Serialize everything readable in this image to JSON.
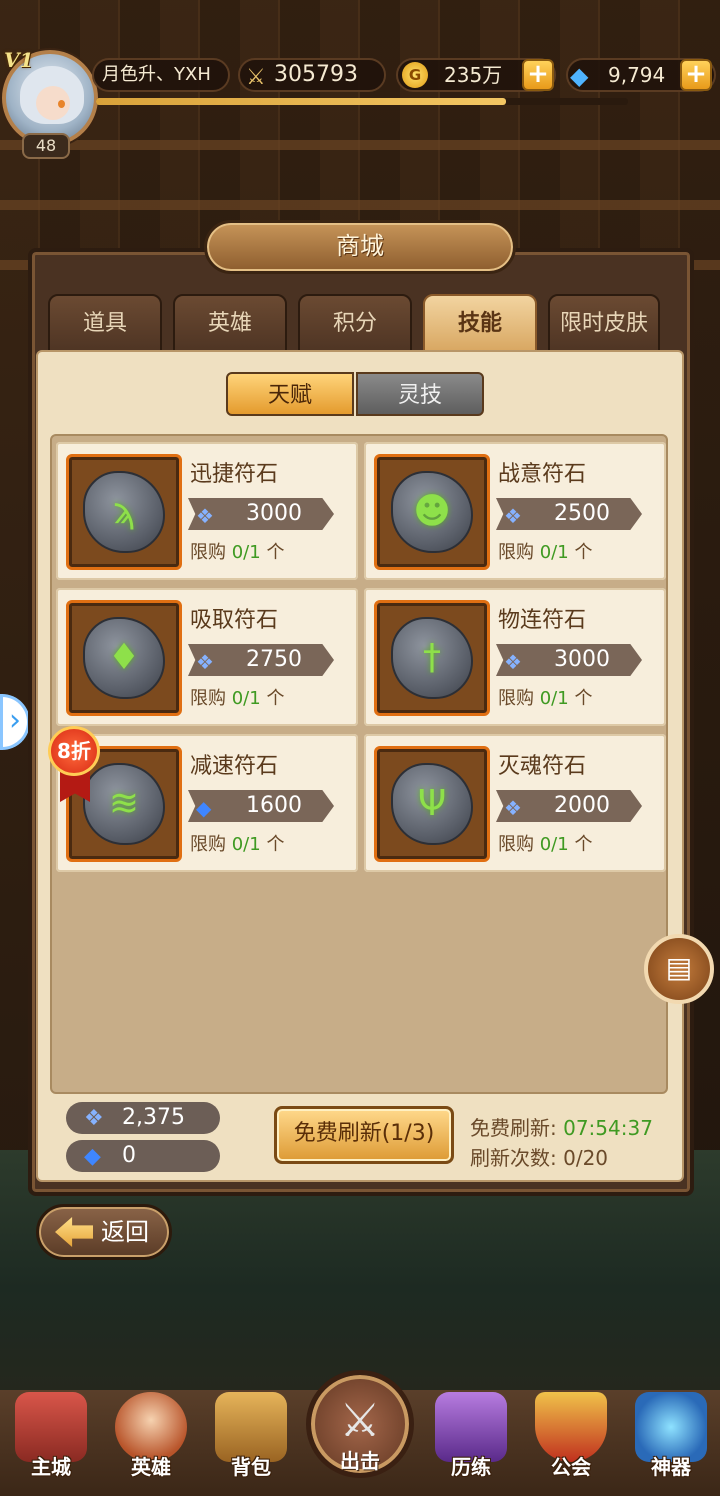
{
  "player": {
    "vip": "V1",
    "name": "月色升、YXH",
    "level": "48",
    "power": "305793",
    "gold": "235万",
    "gems": "9,794",
    "xp_fraction": 0.77
  },
  "shop": {
    "title": "商城",
    "tabs": [
      {
        "label": "道具"
      },
      {
        "label": "英雄"
      },
      {
        "label": "积分"
      },
      {
        "label": "技能"
      },
      {
        "label": "限时皮肤"
      }
    ],
    "active_tab": "技能",
    "subtabs": [
      {
        "label": "天赋"
      },
      {
        "label": "灵技"
      }
    ],
    "items": [
      {
        "name": "迅捷符石",
        "price": "3000",
        "limit_label": "限购",
        "limit": "0/1",
        "unit": "个",
        "icon": "boot-rune-icon"
      },
      {
        "name": "战意符石",
        "price": "2500",
        "limit_label": "限购",
        "limit": "0/1",
        "unit": "个",
        "icon": "demon-rune-icon"
      },
      {
        "name": "吸取符石",
        "price": "2750",
        "limit_label": "限购",
        "limit": "0/1",
        "unit": "个",
        "icon": "drops-rune-icon"
      },
      {
        "name": "物连符石",
        "price": "3000",
        "limit_label": "限购",
        "limit": "0/1",
        "unit": "个",
        "icon": "sword-rune-icon"
      },
      {
        "name": "减速符石",
        "price": "1600",
        "limit_label": "限购",
        "limit": "0/1",
        "unit": "个",
        "icon": "slow-boot-rune-icon",
        "discount": "8折"
      },
      {
        "name": "灭魂符石",
        "price": "2000",
        "limit_label": "限购",
        "limit": "0/1",
        "unit": "个",
        "icon": "trident-skull-rune-icon"
      }
    ],
    "currency1": "2,375",
    "currency2": "0",
    "refresh_button": "免费刷新(1/3)",
    "free_refresh_label": "免费刷新:",
    "free_refresh_timer": "07:54:37",
    "refresh_count_label": "刷新次数:",
    "refresh_count": "0/20"
  },
  "back_label": "返回",
  "nav": [
    {
      "label": "主城"
    },
    {
      "label": "英雄"
    },
    {
      "label": "背包"
    },
    {
      "label": "出击"
    },
    {
      "label": "历练"
    },
    {
      "label": "公会"
    },
    {
      "label": "神器"
    }
  ],
  "colors": {
    "accent": "#e49b2e",
    "green": "#3f9a22",
    "icon_border": "#e06f12"
  }
}
